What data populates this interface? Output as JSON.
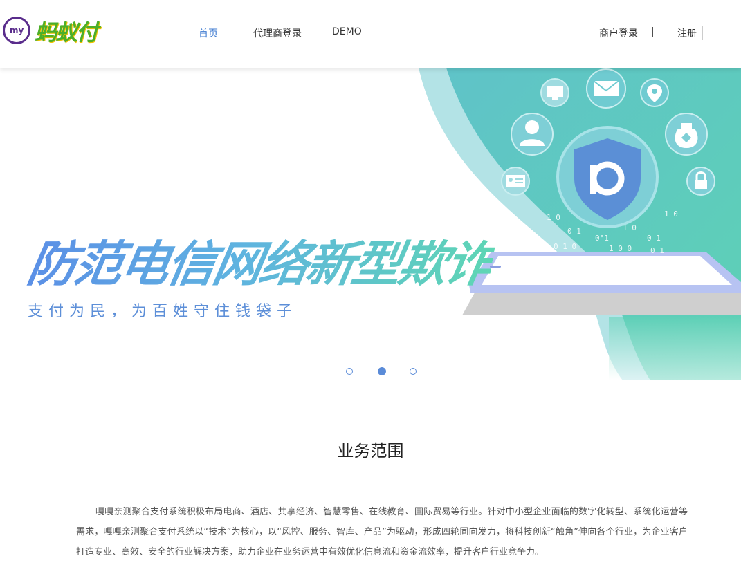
{
  "header": {
    "logo_mark": "my",
    "logo_text": "蚂蚁付",
    "nav": {
      "home": "首页",
      "agent_login": "代理商登录",
      "demo": "DEMO",
      "merchant_login": "商户登录",
      "separator": "|",
      "register": "注册"
    }
  },
  "banner": {
    "headline": "防范电信网络新型欺诈",
    "subline": "支付为民，为百姓守住钱袋子",
    "slides_total": 3,
    "active_slide": 2
  },
  "section": {
    "title": "业务范围",
    "text": "嘎嘎亲测聚合支付系统积极布局电商、酒店、共享经济、智慧零售、在线教育、国际贸易等行业。针对中小型企业面临的数字化转型、系统化运营等需求，嘎嘎亲测聚合支付系统以“技术”为核心，以“风控、服务、智库、产品”为驱动，形成四轮同向发力，将科技创新“触角”伸向各个行业，为企业客户打造专业、高效、安全的行业解决方案，助力企业在业务运营中有效优化信息流和资金流效率，提升客户行业竞争力。"
  },
  "colors": {
    "accent_blue": "#3f7bd0",
    "teal": "#5ccdb8",
    "dot_blue": "#5a8bd8"
  }
}
